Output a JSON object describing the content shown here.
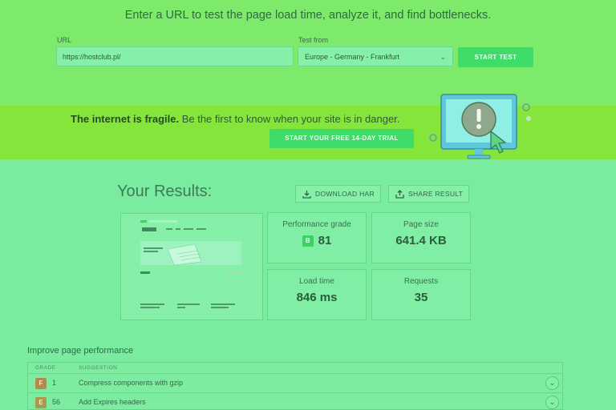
{
  "hero": {
    "title": "Enter a URL to test the page load time, analyze it, and find bottlenecks.",
    "url_label": "URL",
    "url_value": "https://hostclub.pl/",
    "test_from_label": "Test from",
    "test_from_value": "Europe - Germany - Frankfurt",
    "start_button": "START TEST"
  },
  "promo": {
    "bold_text": "The internet is fragile.",
    "text": " Be the first to know when your site is in danger.",
    "trial_button": "START YOUR FREE 14-DAY TRIAL"
  },
  "results": {
    "title": "Your Results:",
    "download_har": "DOWNLOAD HAR",
    "share_result": "SHARE RESULT",
    "performance_grade_label": "Performance grade",
    "performance_grade_letter": "B",
    "performance_grade_value": "81",
    "page_size_label": "Page size",
    "page_size_value": "641.4 KB",
    "load_time_label": "Load time",
    "load_time_value": "846 ms",
    "requests_label": "Requests",
    "requests_value": "35"
  },
  "improve": {
    "title": "Improve page performance",
    "col_grade": "GRADE",
    "col_suggestion": "SUGGESTION",
    "rows": [
      {
        "grade": "F",
        "score": "1",
        "suggestion": "Compress components with gzip"
      },
      {
        "grade": "E",
        "score": "56",
        "suggestion": "Add Expires headers"
      }
    ]
  },
  "colors": {
    "hero_bg": "#7eea6c",
    "promo_bg": "#85e53a",
    "page_bg": "#79eca0",
    "accent_button": "#3fdc6a"
  },
  "icons": [
    "chevron-down-icon",
    "download-icon",
    "share-icon",
    "alert-icon",
    "cursor-icon"
  ]
}
